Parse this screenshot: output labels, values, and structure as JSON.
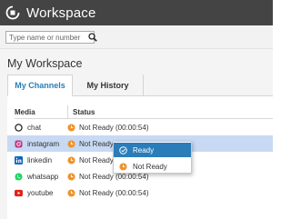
{
  "app": {
    "title": "Workspace",
    "logo_icon": "workspace-logo-icon"
  },
  "search": {
    "placeholder": "Type name or number",
    "value": ""
  },
  "page": {
    "title": "My Workspace"
  },
  "tabs": [
    {
      "label": "My Channels",
      "active": true
    },
    {
      "label": "My History",
      "active": false
    }
  ],
  "table": {
    "headers": {
      "media": "Media",
      "status": "Status"
    },
    "rows": [
      {
        "media": "chat",
        "icon": "chat-icon",
        "status": "Not Ready (00:00:54)",
        "selected": false
      },
      {
        "media": "instagram",
        "icon": "instagram-icon",
        "status": "Not Ready (00:00:54)",
        "selected": true
      },
      {
        "media": "linkedin",
        "icon": "linkedin-icon",
        "status": "Not Ready (00:00:54)",
        "selected": false
      },
      {
        "media": "whatsapp",
        "icon": "whatsapp-icon",
        "status": "Not Ready (00:00:54)",
        "selected": false
      },
      {
        "media": "youtube",
        "icon": "youtube-icon",
        "status": "Not Ready (00:00:54)",
        "selected": false
      }
    ]
  },
  "status_menu": {
    "items": [
      {
        "label": "Ready",
        "icon": "ready-check-icon",
        "highlighted": true
      },
      {
        "label": "Not Ready",
        "icon": "not-ready-clock-icon",
        "highlighted": false
      }
    ]
  },
  "colors": {
    "titlebar": "#444444",
    "accent": "#2a7db8",
    "selected_row": "#c8d9f3",
    "not_ready": "#f0932b",
    "ready": "#2a7db8"
  }
}
